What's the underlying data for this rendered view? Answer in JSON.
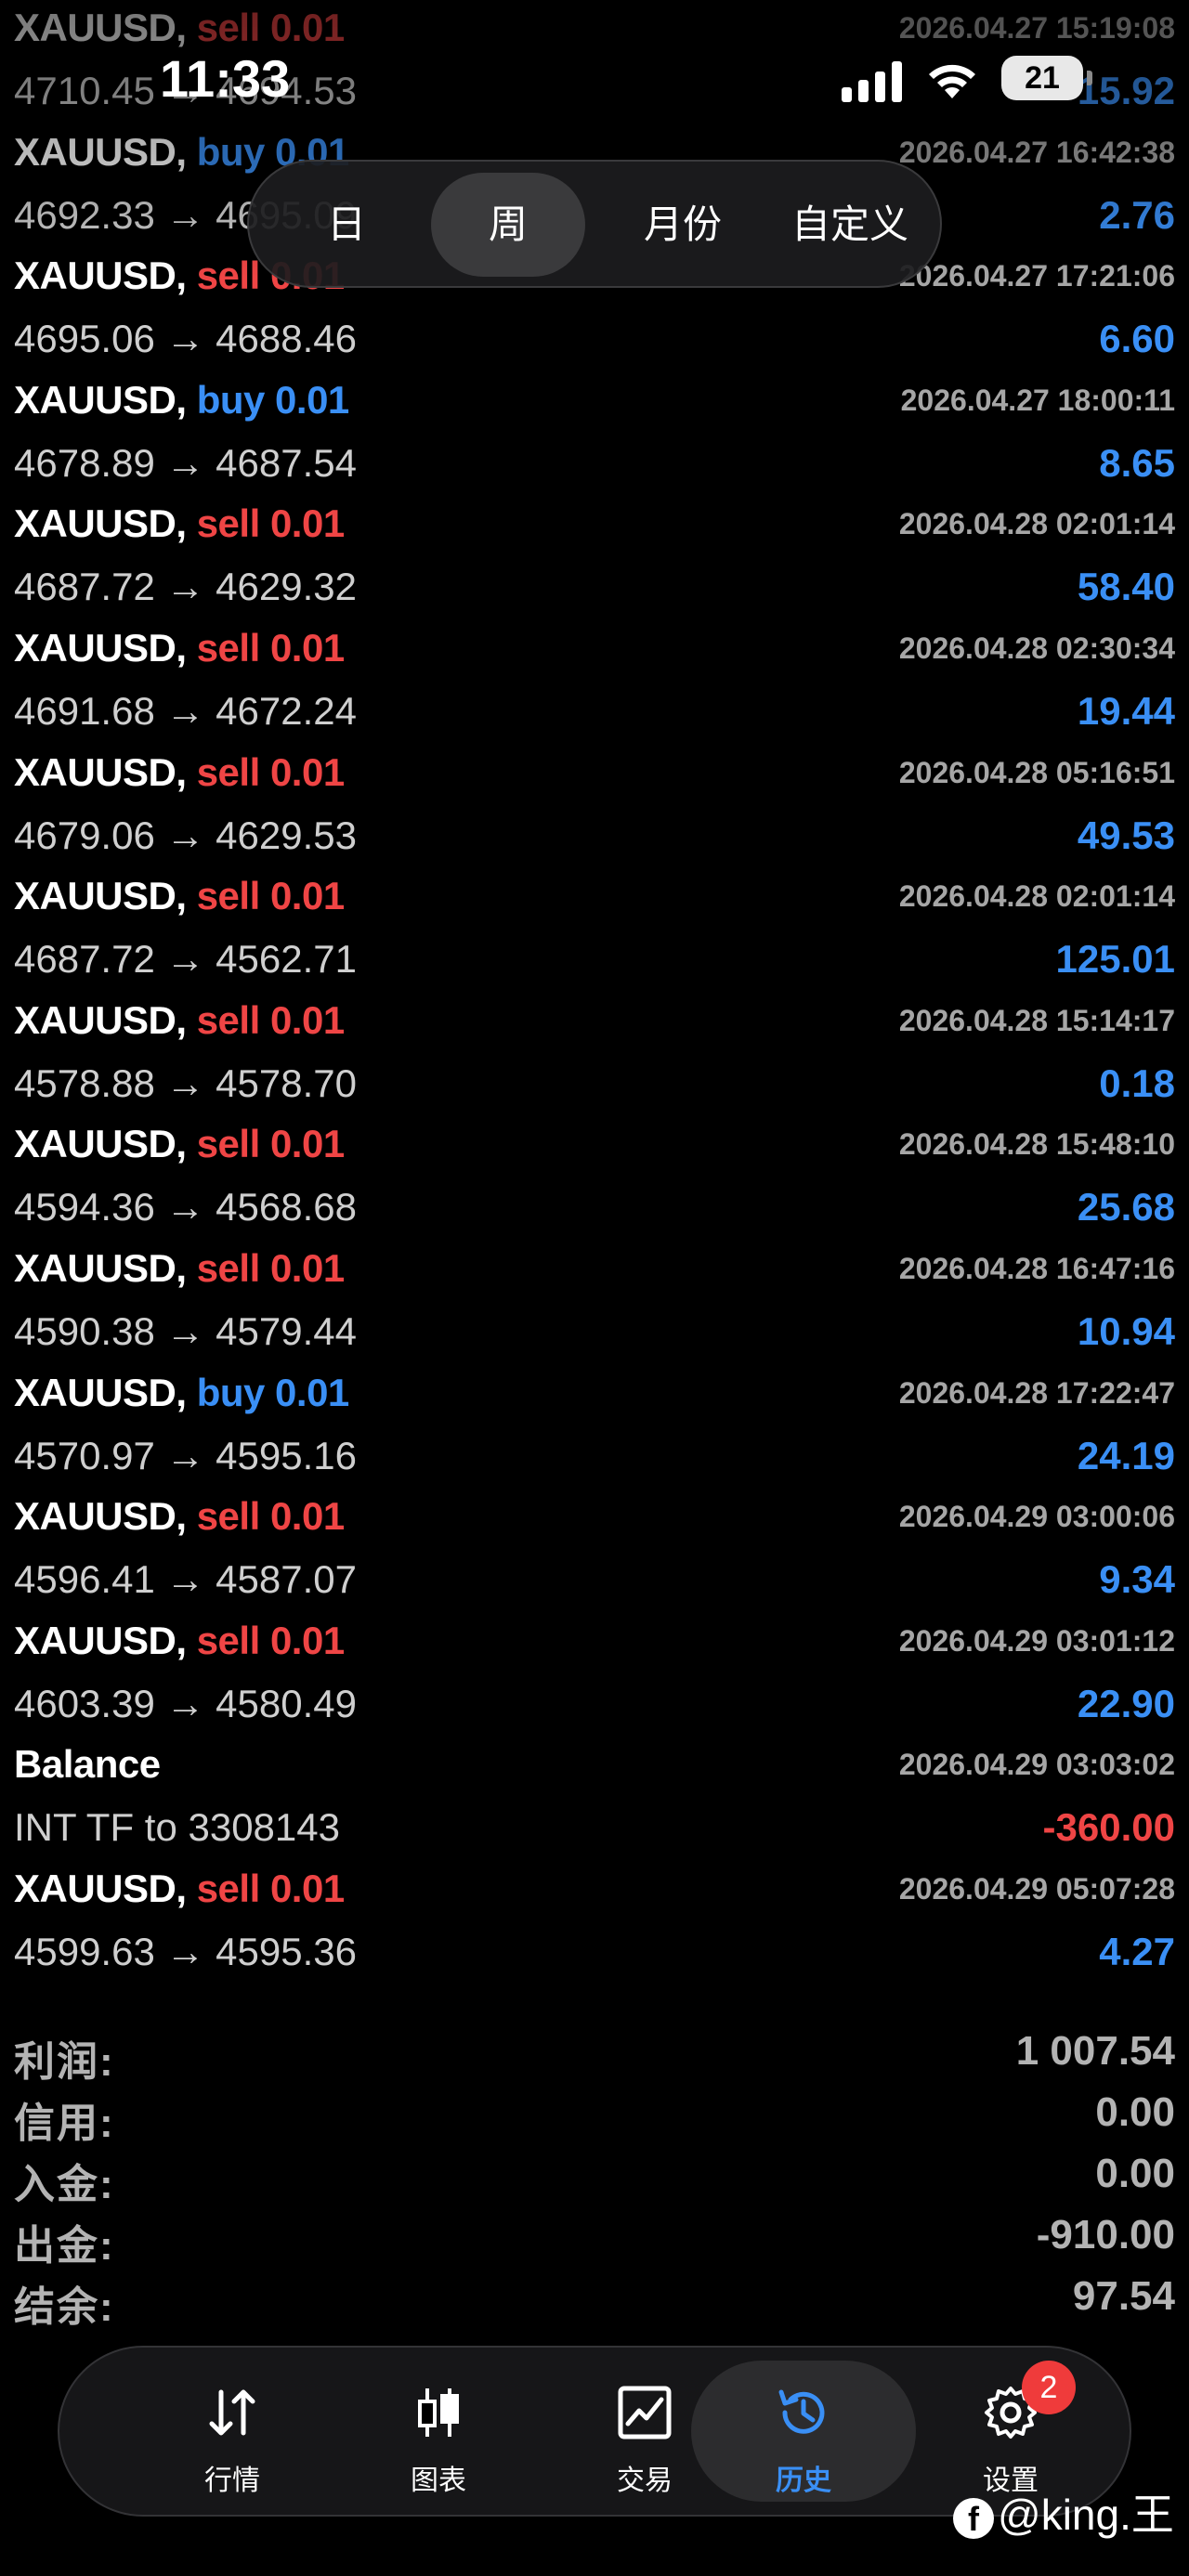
{
  "status_bar": {
    "time": "11:33",
    "battery": "21"
  },
  "period_tabs": {
    "options": [
      "日",
      "周",
      "月份",
      "自定义"
    ],
    "selected": "周"
  },
  "deals": [
    {
      "symbol": "XAUUSD,",
      "side": "sell",
      "volume": "0.01",
      "time": "2026.04.27 15:19:08",
      "open": "4710.45",
      "close": "4694.53",
      "profit": "15.92"
    },
    {
      "symbol": "XAUUSD,",
      "side": "buy",
      "volume": "0.01",
      "time": "2026.04.27 16:42:38",
      "open": "4692.33",
      "close": "4695.09",
      "profit": "2.76"
    },
    {
      "symbol": "XAUUSD,",
      "side": "sell",
      "volume": "0.01",
      "time": "2026.04.27 17:21:06",
      "open": "4695.06",
      "close": "4688.46",
      "profit": "6.60"
    },
    {
      "symbol": "XAUUSD,",
      "side": "buy",
      "volume": "0.01",
      "time": "2026.04.27 18:00:11",
      "open": "4678.89",
      "close": "4687.54",
      "profit": "8.65"
    },
    {
      "symbol": "XAUUSD,",
      "side": "sell",
      "volume": "0.01",
      "time": "2026.04.28 02:01:14",
      "open": "4687.72",
      "close": "4629.32",
      "profit": "58.40"
    },
    {
      "symbol": "XAUUSD,",
      "side": "sell",
      "volume": "0.01",
      "time": "2026.04.28 02:30:34",
      "open": "4691.68",
      "close": "4672.24",
      "profit": "19.44"
    },
    {
      "symbol": "XAUUSD,",
      "side": "sell",
      "volume": "0.01",
      "time": "2026.04.28 05:16:51",
      "open": "4679.06",
      "close": "4629.53",
      "profit": "49.53"
    },
    {
      "symbol": "XAUUSD,",
      "side": "sell",
      "volume": "0.01",
      "time": "2026.04.28 02:01:14",
      "open": "4687.72",
      "close": "4562.71",
      "profit": "125.01"
    },
    {
      "symbol": "XAUUSD,",
      "side": "sell",
      "volume": "0.01",
      "time": "2026.04.28 15:14:17",
      "open": "4578.88",
      "close": "4578.70",
      "profit": "0.18"
    },
    {
      "symbol": "XAUUSD,",
      "side": "sell",
      "volume": "0.01",
      "time": "2026.04.28 15:48:10",
      "open": "4594.36",
      "close": "4568.68",
      "profit": "25.68"
    },
    {
      "symbol": "XAUUSD,",
      "side": "sell",
      "volume": "0.01",
      "time": "2026.04.28 16:47:16",
      "open": "4590.38",
      "close": "4579.44",
      "profit": "10.94"
    },
    {
      "symbol": "XAUUSD,",
      "side": "buy",
      "volume": "0.01",
      "time": "2026.04.28 17:22:47",
      "open": "4570.97",
      "close": "4595.16",
      "profit": "24.19"
    },
    {
      "symbol": "XAUUSD,",
      "side": "sell",
      "volume": "0.01",
      "time": "2026.04.29 03:00:06",
      "open": "4596.41",
      "close": "4587.07",
      "profit": "9.34"
    },
    {
      "symbol": "XAUUSD,",
      "side": "sell",
      "volume": "0.01",
      "time": "2026.04.29 03:01:12",
      "open": "4603.39",
      "close": "4580.49",
      "profit": "22.90"
    },
    {
      "type": "balance",
      "title": "Balance",
      "time": "2026.04.29 03:03:02",
      "comment": "INT TF to 3308143",
      "profit": "-360.00"
    },
    {
      "symbol": "XAUUSD,",
      "side": "sell",
      "volume": "0.01",
      "time": "2026.04.29 05:07:28",
      "open": "4599.63",
      "close": "4595.36",
      "profit": "4.27"
    }
  ],
  "arrow": "→",
  "summary": [
    {
      "label": "利润:",
      "value": "1 007.54"
    },
    {
      "label": "信用:",
      "value": "0.00"
    },
    {
      "label": "入金:",
      "value": "0.00"
    },
    {
      "label": "出金:",
      "value": "-910.00"
    },
    {
      "label": "结余:",
      "value": "97.54"
    }
  ],
  "tab_bar": {
    "tabs": [
      {
        "label": "行情",
        "icon": "arrows-updown-icon"
      },
      {
        "label": "图表",
        "icon": "candlestick-icon"
      },
      {
        "label": "交易",
        "icon": "trade-chart-icon"
      },
      {
        "label": "历史",
        "icon": "history-clock-icon"
      },
      {
        "label": "设置",
        "icon": "gear-icon"
      }
    ],
    "active": "历史",
    "settings_badge": "2"
  },
  "watermark": "@king.王",
  "colors": {
    "sell": "#ef4545",
    "buy": "#3a8ff5",
    "profit_positive": "#3a8ff5",
    "profit_negative": "#ef4545",
    "accent": "#3a8ff5"
  }
}
